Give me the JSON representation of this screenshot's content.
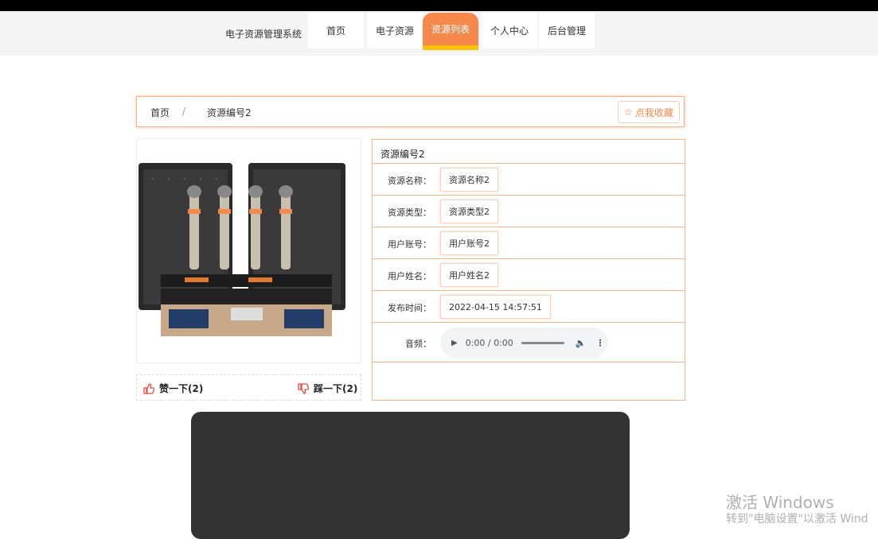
{
  "header": {
    "brand": "电子资源管理系统",
    "nav": [
      {
        "label": "首页",
        "active": false
      },
      {
        "label": "电子资源",
        "active": false
      },
      {
        "label": "资源列表",
        "active": true
      },
      {
        "label": "个人中心",
        "active": false
      },
      {
        "label": "后台管理",
        "active": false
      }
    ]
  },
  "breadcrumb": {
    "home": "首页",
    "separator": "/",
    "current": "资源编号2",
    "favorite_label": "点我收藏"
  },
  "votes": {
    "like_label": "赞一下(2)",
    "dislike_label": "踩一下(2)"
  },
  "detail": {
    "title": "资源编号2",
    "fields": [
      {
        "label": "资源名称：",
        "value": "资源名称2"
      },
      {
        "label": "资源类型：",
        "value": "资源类型2"
      },
      {
        "label": "用户账号：",
        "value": "用户账号2"
      },
      {
        "label": "用户姓名：",
        "value": "用户姓名2"
      },
      {
        "label": "发布时间：",
        "value": "2022-04-15 14:57:51"
      }
    ],
    "audio_label": "音频：",
    "audio_time": "0:00 / 0:00"
  },
  "watermark": {
    "line1": "激活 Windows",
    "line2": "转到\"电脑设置\"以激活 Wind"
  },
  "colors": {
    "accent": "#f5884a",
    "active_underline": "#ffc000",
    "border_accent": "#f5b488",
    "dark_panel": "#333333"
  }
}
